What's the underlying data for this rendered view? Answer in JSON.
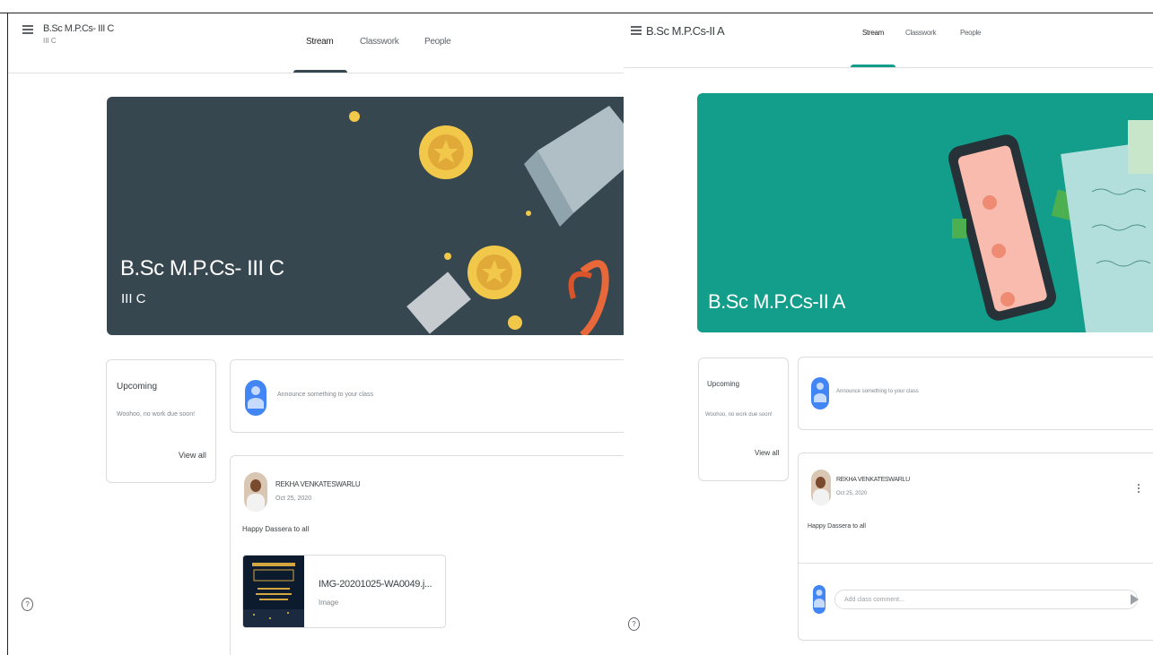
{
  "left": {
    "header": {
      "class_title": "B.Sc M.P.Cs- III C",
      "class_section": "III C"
    },
    "tabs": [
      {
        "label": "Stream"
      },
      {
        "label": "Classwork"
      },
      {
        "label": "People"
      }
    ],
    "banner": {
      "title": "B.Sc M.P.Cs- III C",
      "subtitle": "III C",
      "color": "#37474f"
    },
    "upcoming": {
      "title": "Upcoming",
      "text": "Woohoo, no work due soon!",
      "view_all": "View all"
    },
    "announce": {
      "placeholder": "Announce something to your class"
    },
    "post": {
      "author": "REKHA VENKATESWARLU",
      "date": "Oct 25, 2020",
      "text": "Happy Dassera to all",
      "attachment": {
        "name": "IMG-20201025-WA0049.j...",
        "type": "Image"
      }
    },
    "help": "?"
  },
  "right": {
    "header": {
      "class_title": "B.Sc M.P.Cs-II A"
    },
    "tabs": [
      {
        "label": "Stream"
      },
      {
        "label": "Classwork"
      },
      {
        "label": "People"
      }
    ],
    "banner": {
      "title": "B.Sc M.P.Cs-II A",
      "color": "#129e8a"
    },
    "upcoming": {
      "title": "Upcoming",
      "text": "Woohoo, no work due soon!",
      "view_all": "View all"
    },
    "announce": {
      "placeholder": "Announce something to your class"
    },
    "post": {
      "author": "REKHA VENKATESWARLU",
      "date": "Oct 25, 2020",
      "text": "Happy Dassera to all",
      "comment_placeholder": "Add class comment..."
    },
    "help": "?"
  },
  "colors": {
    "accent_left": "#37474f",
    "accent_right": "#129e8a",
    "avatar_blue": "#4285f4"
  }
}
